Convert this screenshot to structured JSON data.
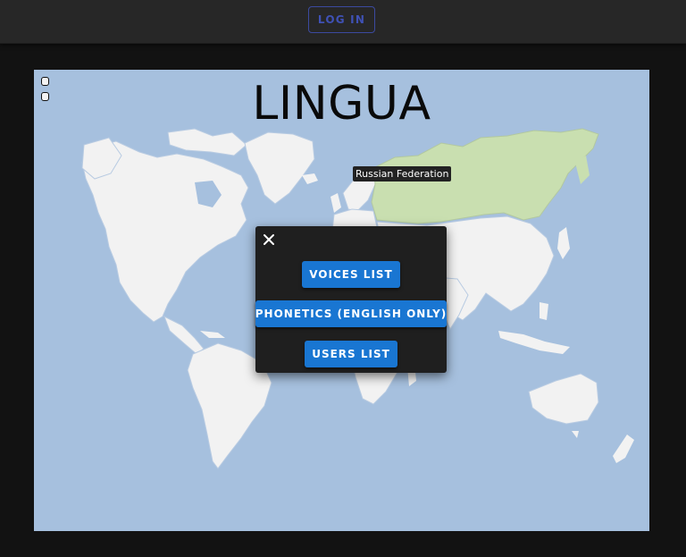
{
  "header": {
    "login_label": "LOG IN"
  },
  "map": {
    "title": "LINGUA",
    "hover_tooltip": "Russian Federation",
    "colors": {
      "ocean": "#a6c0de",
      "land": "#f2f2f2",
      "highlight": "#c9dfb0",
      "borders": "#a6c0de"
    }
  },
  "menu_dialog": {
    "close_icon": "close-icon",
    "buttons": [
      {
        "label": "VOICES LIST"
      },
      {
        "label": "PHONETICS (ENGLISH ONLY)"
      },
      {
        "label": "USERS LIST"
      }
    ],
    "button_color": "#1976d2"
  }
}
